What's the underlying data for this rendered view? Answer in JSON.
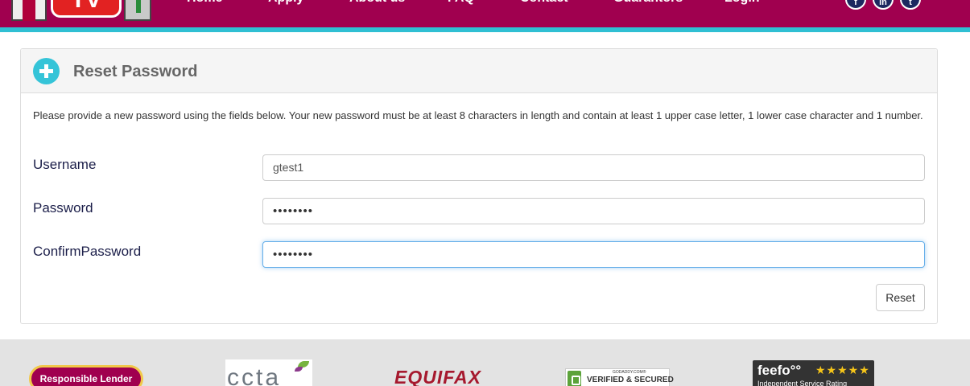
{
  "header": {
    "logo_text": "TV",
    "nav": [
      {
        "label": "Home"
      },
      {
        "label": "Apply"
      },
      {
        "label": "About us"
      },
      {
        "label": "FAQ"
      },
      {
        "label": "Contact"
      },
      {
        "label": "Guarantors"
      },
      {
        "label": "Login"
      }
    ],
    "social": [
      {
        "icon": "facebook-icon",
        "glyph": "f"
      },
      {
        "icon": "linkedin-icon",
        "glyph": "in"
      },
      {
        "icon": "twitter-icon",
        "glyph": "t"
      }
    ],
    "colors": {
      "bar": "#a0004f",
      "stripe": "#2fbfd3"
    }
  },
  "panel": {
    "title": "Reset Password",
    "instructions": "Please provide a new password using the fields below. Your new password must be at least 8 characters in length and contain at least 1 upper case letter, 1 lower case character and 1 number.",
    "fields": [
      {
        "label": "Username",
        "value": "gtest1"
      },
      {
        "label": "Password",
        "value": "••••••••"
      },
      {
        "label": "ConfirmPassword",
        "value": "••••••••"
      }
    ],
    "reset_label": "Reset",
    "accent": "#35c4d8"
  },
  "footer": {
    "responsible": "Responsible Lender",
    "ccta": "ccta",
    "equifax": "EQUIFAX",
    "godaddy_small": "GODADDY.COM®",
    "godaddy_main": "VERIFIED & SECURED",
    "feefo_logo": "feefo°°",
    "feefo_stars": "★★★★★",
    "feefo_sub": "Independent Service Rating"
  }
}
